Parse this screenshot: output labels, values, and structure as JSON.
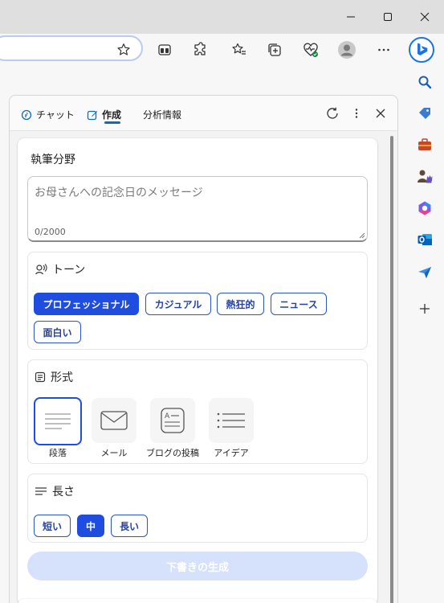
{
  "window": {
    "minimize_icon": "minimize-icon",
    "maximize_icon": "maximize-icon",
    "close_icon": "close-icon"
  },
  "toolbar": {
    "address_value": "",
    "icons": [
      "favorite-star-icon",
      "split-screen-icon",
      "extensions-icon",
      "favorites-icon",
      "collections-icon",
      "browser-essentials-icon",
      "profile-avatar-icon",
      "more-icon",
      "copilot-icon"
    ]
  },
  "sidebar": {
    "icons": [
      "search-icon",
      "shopping-icon",
      "tools-icon",
      "games-icon",
      "microsoft365-icon",
      "outlook-icon",
      "drop-icon",
      "add-icon"
    ]
  },
  "pane": {
    "tabs": [
      {
        "label": "チャット",
        "icon": "chat-icon"
      },
      {
        "label": "作成",
        "icon": "compose-icon"
      },
      {
        "label": "分析情報",
        "icon": ""
      }
    ],
    "active_tab": "作成"
  },
  "compose": {
    "field_label": "執筆分野",
    "placeholder": "お母さんへの記念日のメッセージ",
    "char_count": "0/2000",
    "tone": {
      "title": "トーン",
      "options": [
        "プロフェッショナル",
        "カジュアル",
        "熱狂的",
        "ニュース",
        "面白い"
      ],
      "selected": "プロフェッショナル"
    },
    "format": {
      "title": "形式",
      "options": [
        "段落",
        "メール",
        "ブログの投稿",
        "アイデア"
      ],
      "selected": "段落"
    },
    "length": {
      "title": "長さ",
      "options": [
        "短い",
        "中",
        "長い"
      ],
      "selected": "中"
    },
    "generate_label": "下書きの生成"
  },
  "colors": {
    "accent": "#1e4de0",
    "chip_text": "#2342a8",
    "generate_disabled": "#d6e2fb"
  }
}
